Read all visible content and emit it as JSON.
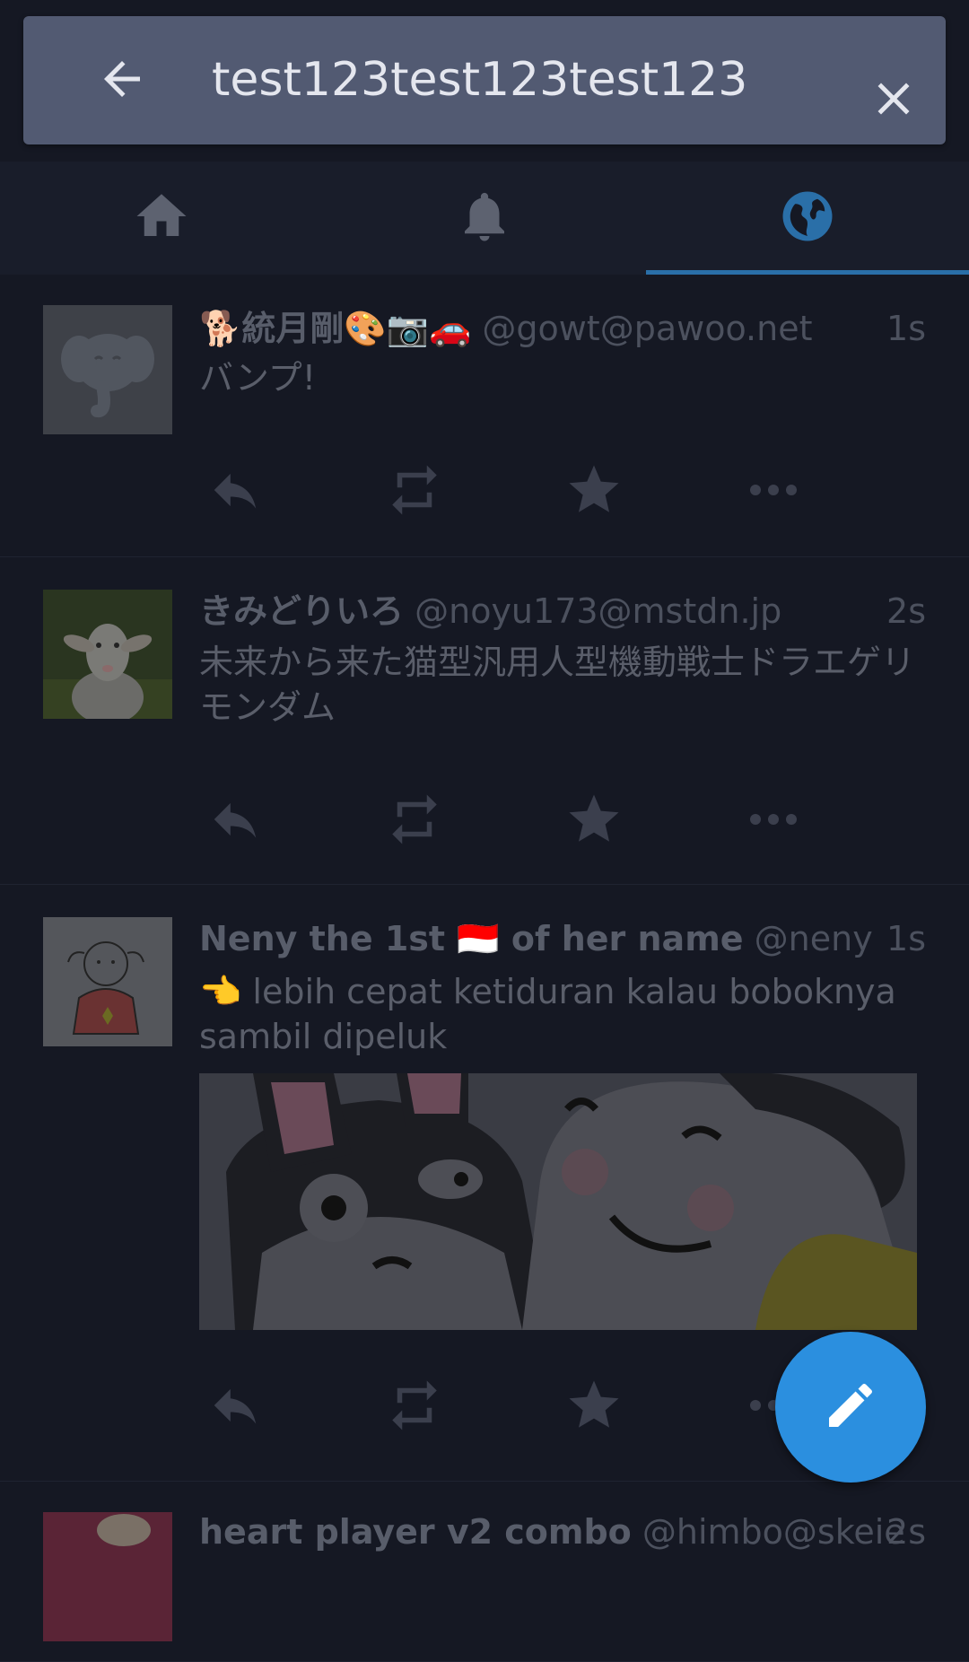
{
  "search": {
    "query": "test123test123test123"
  },
  "tabs": [
    {
      "name": "home-icon"
    },
    {
      "name": "bell-icon"
    },
    {
      "name": "globe-icon",
      "active": true
    }
  ],
  "statuses": [
    {
      "display_name": "🐕統月剛🎨📷🚗",
      "account": "@gowt@pawoo.net",
      "time": "1s",
      "content": "バンプ!"
    },
    {
      "display_name": "きみどりいろ",
      "account": "@noyu173@mstdn.jp",
      "time": "2s",
      "content": "未来から来た猫型汎用人型機動戦士ドラエゲリモンダム"
    },
    {
      "display_name": "Neny the 1st 🇮🇩 of her name",
      "account": "@neny",
      "time": "1s",
      "content": "👈 lebih cepat ketiduran kalau boboknya sambil dipeluk"
    },
    {
      "display_name": "heart player v2 combo",
      "account": "@himbo@skeie",
      "time": "2s"
    }
  ],
  "colors": {
    "accent": "#2b8fdf",
    "search_bg": "#525a72",
    "bg": "#151823"
  }
}
